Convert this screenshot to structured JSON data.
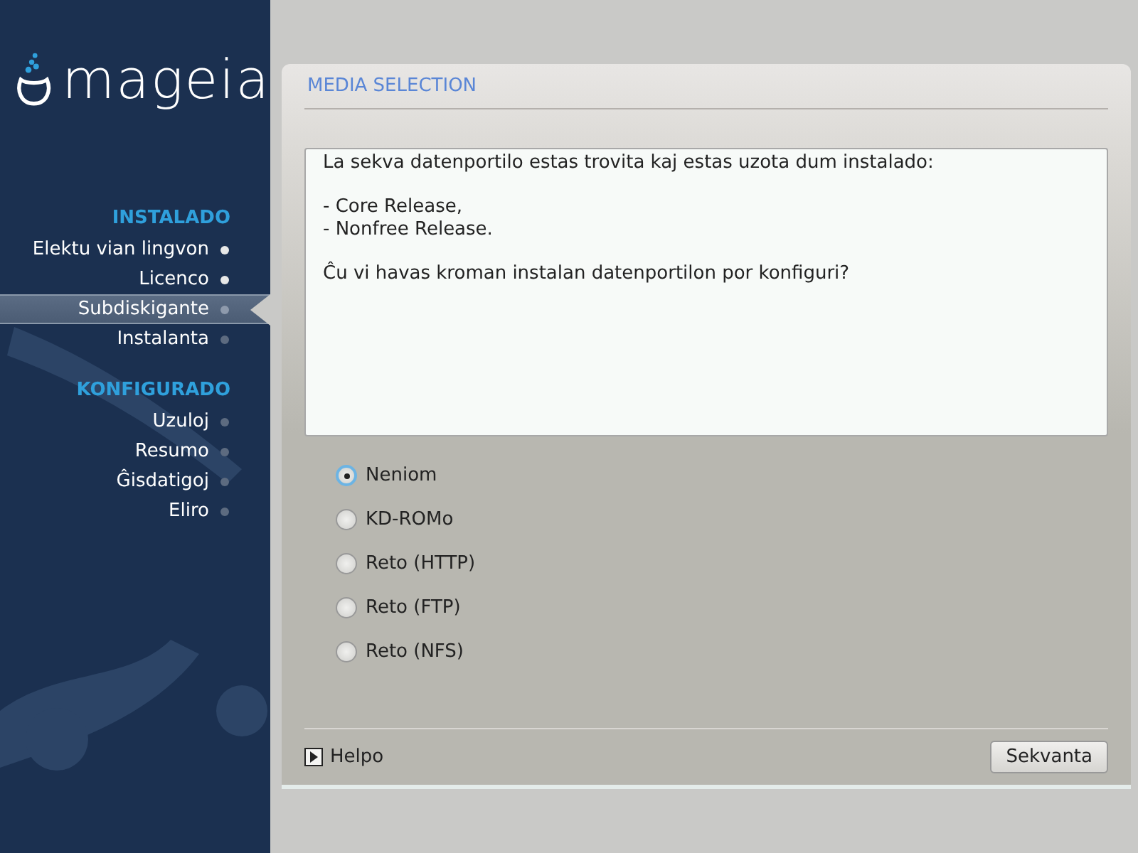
{
  "logo": "mageia",
  "sidebar": {
    "sections": [
      {
        "title": "INSTALADO",
        "items": [
          {
            "label": "Elektu vian lingvon",
            "done": true,
            "selected": false
          },
          {
            "label": "Licenco",
            "done": true,
            "selected": false
          },
          {
            "label": "Subdiskigante",
            "done": false,
            "selected": true
          },
          {
            "label": "Instalanta",
            "done": false,
            "selected": false
          }
        ]
      },
      {
        "title": "KONFIGURADO",
        "items": [
          {
            "label": "Uzuloj",
            "done": false,
            "selected": false
          },
          {
            "label": "Resumo",
            "done": false,
            "selected": false
          },
          {
            "label": "Ĝisdatigoj",
            "done": false,
            "selected": false
          },
          {
            "label": "Eliro",
            "done": false,
            "selected": false
          }
        ]
      }
    ]
  },
  "panel": {
    "title": "MEDIA SELECTION",
    "message": [
      [
        "La sekva datenportilo estas trovita kaj estas uzota dum instalado:"
      ],
      [
        "- Core Release,",
        "- Nonfree Release."
      ],
      [
        "Ĉu vi havas kroman instalan datenportilon por konfiguri?"
      ]
    ],
    "options": [
      {
        "label": "Neniom",
        "selected": true
      },
      {
        "label": "KD-ROMo",
        "selected": false
      },
      {
        "label": "Reto (HTTP)",
        "selected": false
      },
      {
        "label": "Reto (FTP)",
        "selected": false
      },
      {
        "label": "Reto (NFS)",
        "selected": false
      }
    ],
    "help": "Helpo",
    "next": "Sekvanta"
  }
}
